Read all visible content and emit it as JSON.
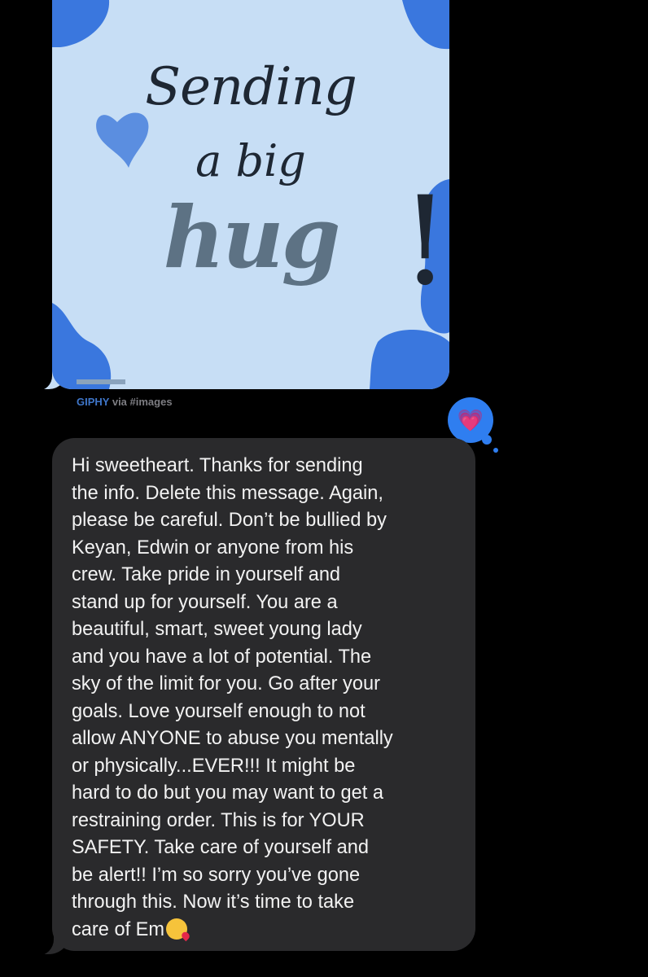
{
  "gif": {
    "line1": "Sending",
    "line2": "a big",
    "line3": "hug",
    "line4": "!",
    "credit_source": "GIPHY",
    "credit_via": "via #images"
  },
  "reaction": {
    "icon": "heart-icon",
    "glyph": "💗"
  },
  "message": {
    "lines": [
      "Hi sweetheart. Thanks for sending",
      "the info. Delete this message. Again,",
      "please be careful. Don’t be bullied by",
      "Keyan, Edwin or anyone from his",
      "crew. Take pride in yourself and",
      "stand up for yourself. You are a",
      "beautiful, smart, sweet young lady",
      "and you have a lot of potential. The",
      "sky of the limit for you. Go after your",
      "goals. Love yourself enough to not",
      "allow ANYONE to abuse you mentally",
      "or physically...EVER!!! It might be",
      "hard to do but you may want to get a",
      "restraining order. This is for YOUR",
      "SAFETY. Take care of yourself and",
      "be alert!! I’m so sorry you’ve gone",
      "through this. Now it’s time to take",
      "care of Em"
    ],
    "trailing_emoji": "face-blowing-kiss-icon"
  },
  "colors": {
    "background": "#000000",
    "bubble": "#2a2a2c",
    "gif_bg": "#c7def5",
    "accent_blue": "#2f7ef0"
  }
}
